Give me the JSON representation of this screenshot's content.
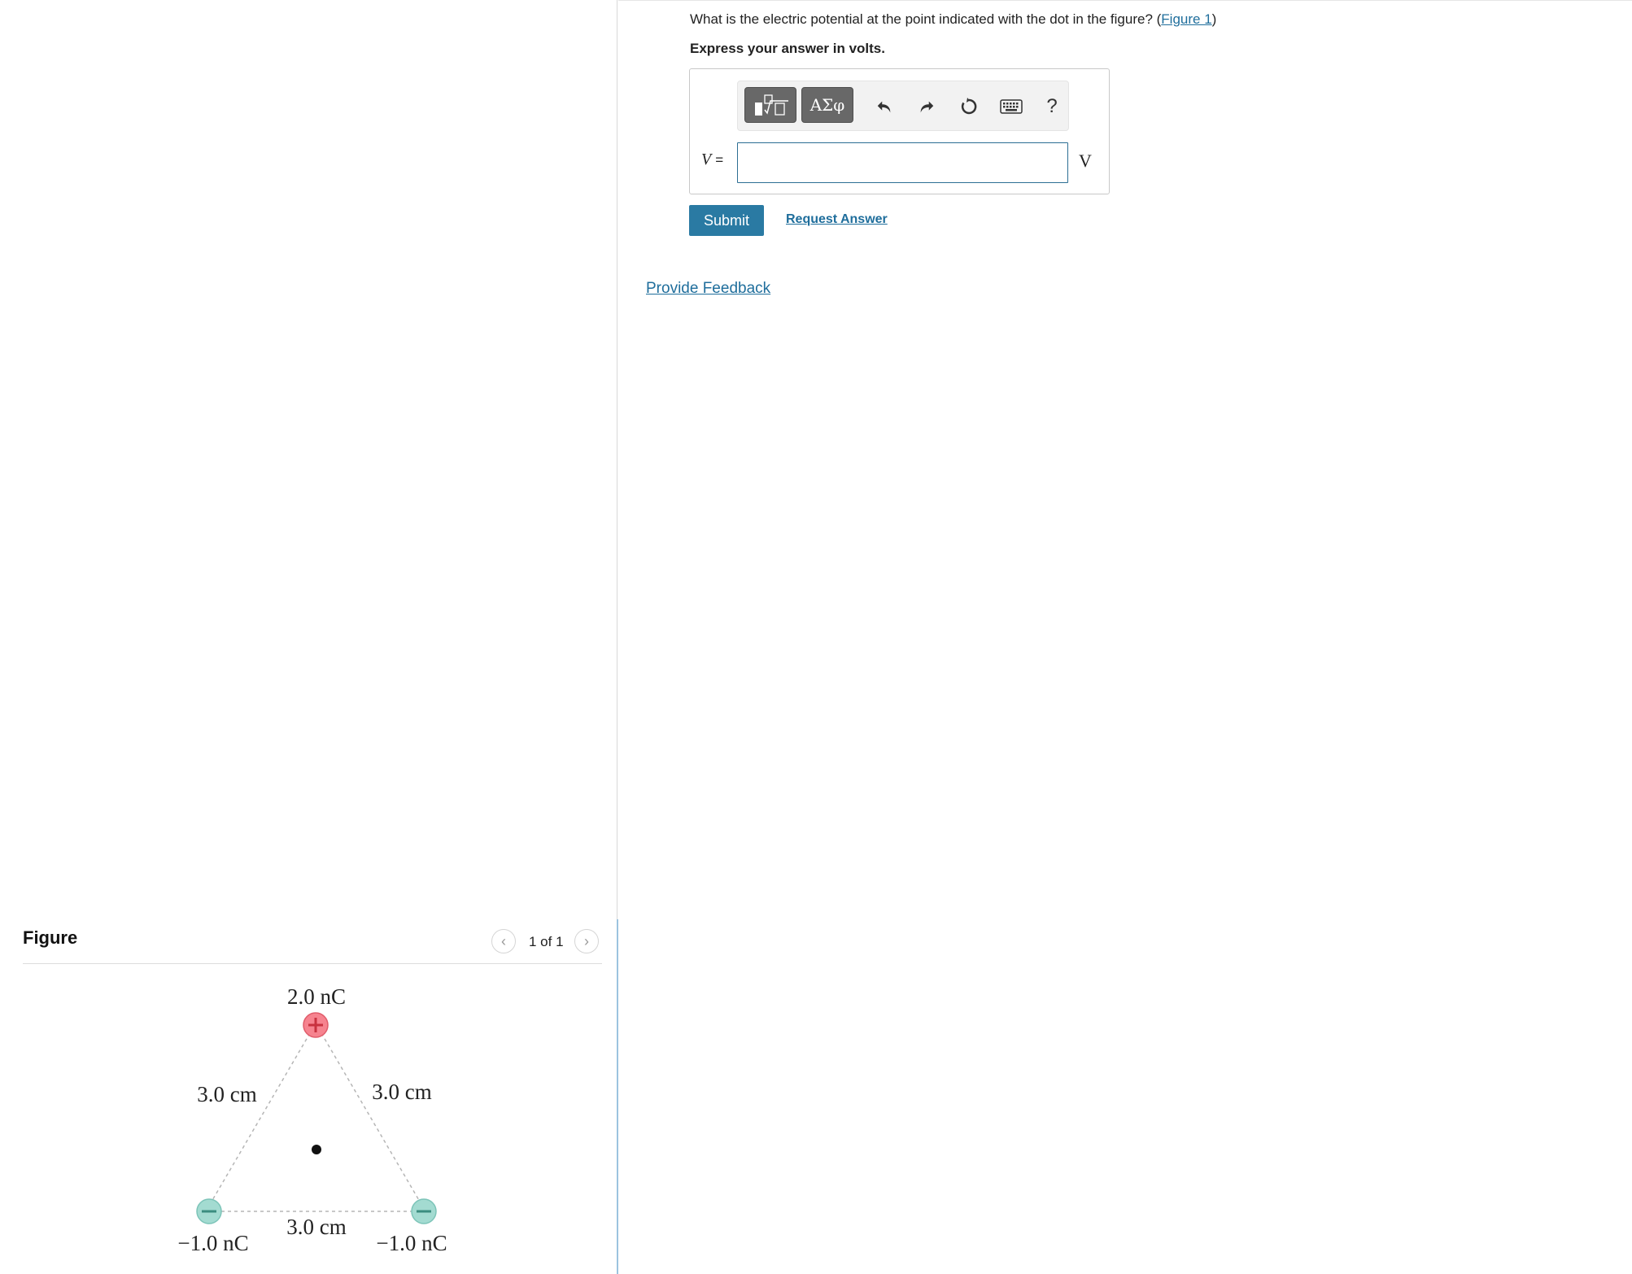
{
  "question": {
    "text": "What is the electric potential at the point indicated with the dot in the figure? (",
    "figure_link": "Figure 1",
    "close_paren": ")",
    "instruction": "Express your answer in volts."
  },
  "answer": {
    "variable": "V",
    "equals": "=",
    "input_value": "",
    "unit": "V"
  },
  "toolbar": {
    "template_icon": "fraction-sqrt-template-icon",
    "greek_label": "ΑΣφ",
    "undo_icon": "undo-icon",
    "redo_icon": "redo-icon",
    "reset_icon": "reset-icon",
    "keyboard_icon": "keyboard-icon",
    "help_label": "?"
  },
  "actions": {
    "submit_label": "Submit",
    "request_answer_label": "Request Answer",
    "feedback_label": "Provide Feedback"
  },
  "figure": {
    "title": "Figure",
    "pager": "1 of 1",
    "prev_icon": "chevron-left-icon",
    "next_icon": "chevron-right-icon",
    "charges": [
      {
        "label": "2.0 nC",
        "sign": "+",
        "color": "#f27a86"
      },
      {
        "label": "−1.0 nC",
        "sign": "−",
        "color": "#8fd0c5"
      },
      {
        "label": "−1.0 nC",
        "sign": "−",
        "color": "#8fd0c5"
      }
    ],
    "sides": [
      "3.0 cm",
      "3.0 cm",
      "3.0 cm"
    ]
  }
}
